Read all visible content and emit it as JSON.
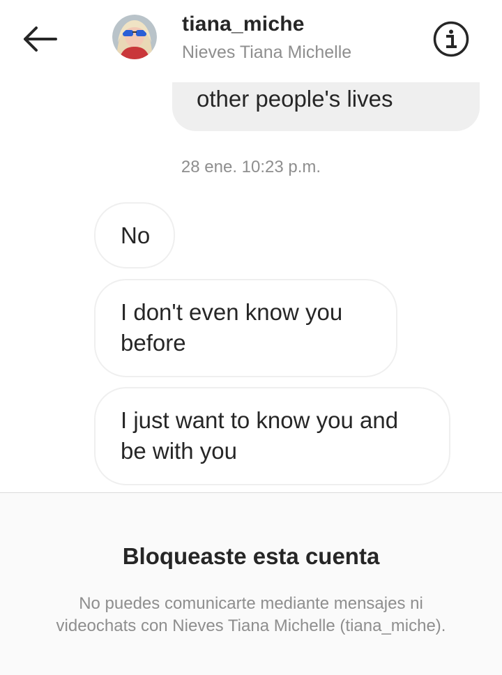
{
  "header": {
    "username": "tiana_miche",
    "full_name": "Nieves Tiana Michelle",
    "back_icon": "arrow-left-icon",
    "info_icon": "info-circle-icon"
  },
  "messages": {
    "outgoing_partial": "other people's lives",
    "timestamp": "28 ene. 10:23 p.m.",
    "incoming": [
      "No",
      "I don't even know you before",
      "I just want to know you and be with you"
    ]
  },
  "blocked_notice": {
    "title": "Bloqueaste esta cuenta",
    "description": "No puedes comunicarte mediante mensajes ni videochats con Nieves Tiana Michelle (tiana_miche)."
  },
  "colors": {
    "text_primary": "#262626",
    "text_secondary": "#8e8e8e",
    "bubble_outgoing": "#efefef",
    "bubble_border": "#efefef",
    "notice_background": "#fafafa"
  }
}
